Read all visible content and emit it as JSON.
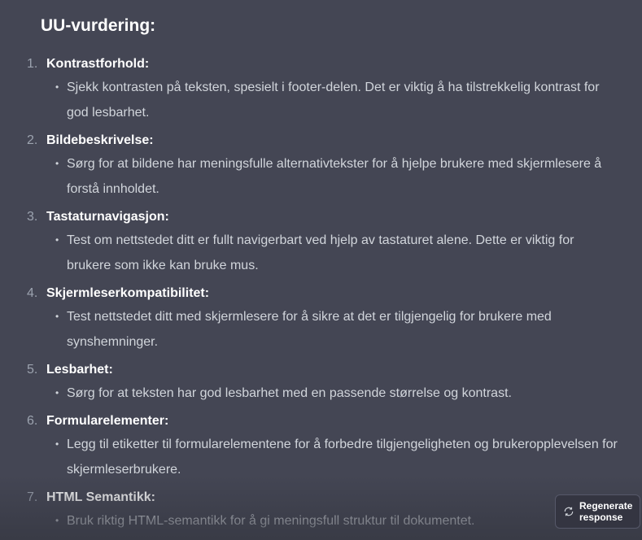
{
  "heading": "UU-vurdering:",
  "items": [
    {
      "num": "1.",
      "title": "Kontrastforhold:",
      "text": "Sjekk kontrasten på teksten, spesielt i footer-delen. Det er viktig å ha tilstrekkelig kontrast for god lesbarhet."
    },
    {
      "num": "2.",
      "title": "Bildebeskrivelse:",
      "text": "Sørg for at bildene har meningsfulle alternativtekster for å hjelpe brukere med skjermlesere å forstå innholdet."
    },
    {
      "num": "3.",
      "title": "Tastaturnavigasjon:",
      "text": "Test om nettstedet ditt er fullt navigerbart ved hjelp av tastaturet alene. Dette er viktig for brukere som ikke kan bruke mus."
    },
    {
      "num": "4.",
      "title": "Skjermleserkompatibilitet:",
      "text": "Test nettstedet ditt med skjermlesere for å sikre at det er tilgjengelig for brukere med synshemninger."
    },
    {
      "num": "5.",
      "title": "Lesbarhet:",
      "text": "Sørg for at teksten har god lesbarhet med en passende størrelse og kontrast."
    },
    {
      "num": "6.",
      "title": "Formularelementer:",
      "text": "Legg til etiketter til formularelementene for å forbedre tilgjengeligheten og brukeropplevelsen for skjermleserbrukere."
    },
    {
      "num": "7.",
      "title": "HTML Semantikk:",
      "text": "Bruk riktig HTML-semantikk for å gi meningsfull struktur til dokumentet."
    }
  ],
  "regenerate_label": "Regenerate response"
}
